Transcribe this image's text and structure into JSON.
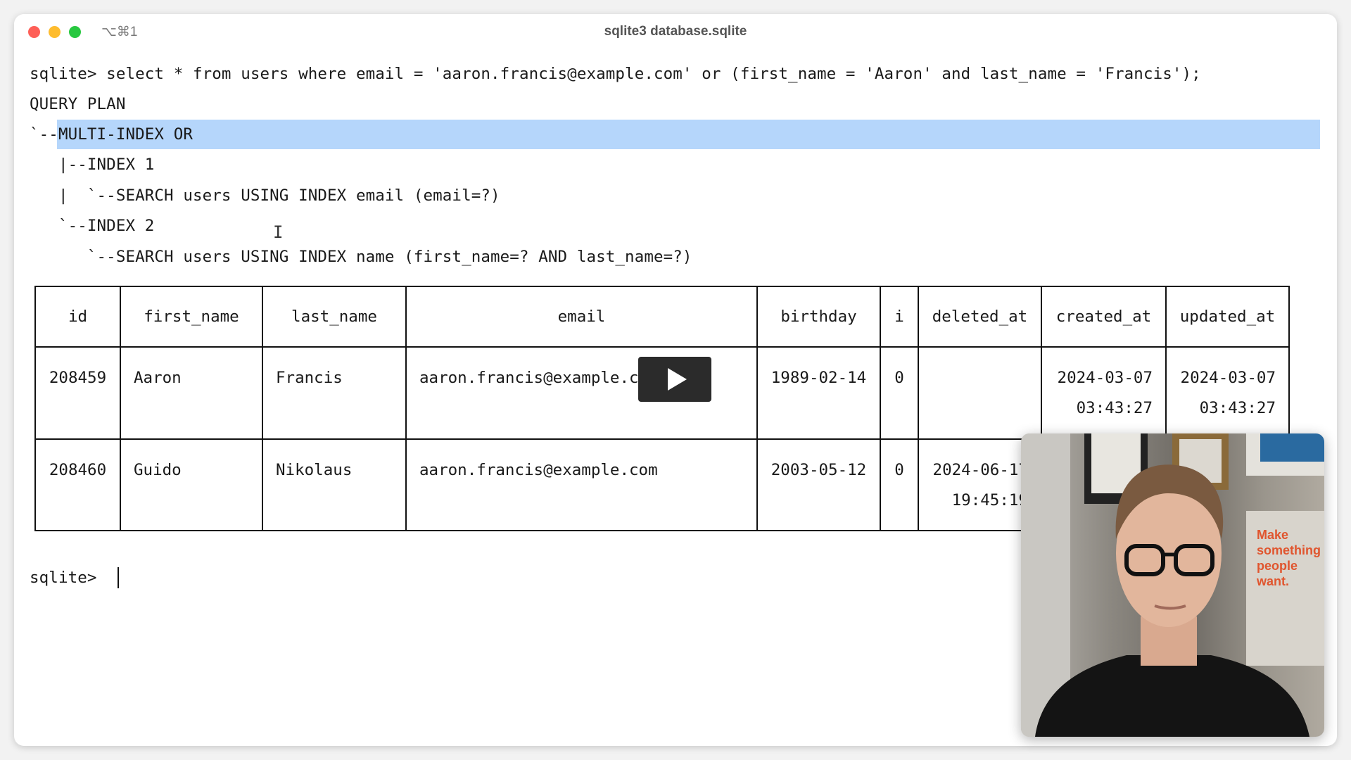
{
  "window": {
    "title": "sqlite3 database.sqlite",
    "shortcut": "⌥⌘1",
    "traffic_lights": {
      "close": "#fe5f57",
      "minimize": "#febc2e",
      "zoom": "#28c840"
    }
  },
  "terminal": {
    "lines": [
      "sqlite> select * from users where email = 'aaron.francis@example.com' or (first_name = 'Aaron' and last_name = 'Francis');",
      "QUERY PLAN",
      "`--MULTI-INDEX OR",
      "   |--INDEX 1",
      "   |  `--SEARCH users USING INDEX email (email=?)",
      "   `--INDEX 2",
      "      `--SEARCH users USING INDEX name (first_name=? AND last_name=?)"
    ],
    "selection_color": "#b5d6fb",
    "prompt": "sqlite> "
  },
  "table": {
    "headers": [
      "id",
      "first_name",
      "last_name",
      "email",
      "birthday",
      "i",
      "deleted_at",
      "created_at",
      "updated_at"
    ],
    "rows": [
      [
        "208459",
        "Aaron",
        "Francis",
        "aaron.francis@example.com",
        "1989-02-14",
        "0",
        "",
        "2024-03-07\n  03:43:27",
        "2024-03-07\n  03:43:27"
      ],
      [
        "208460",
        "Guido",
        "Nikolaus",
        "aaron.francis@example.com",
        "2003-05-12",
        "0",
        "2024-06-17\n  19:45:19",
        "",
        ""
      ]
    ]
  },
  "overlay": {
    "play_icon": "play-icon",
    "webcam": "presenter-webcam"
  }
}
